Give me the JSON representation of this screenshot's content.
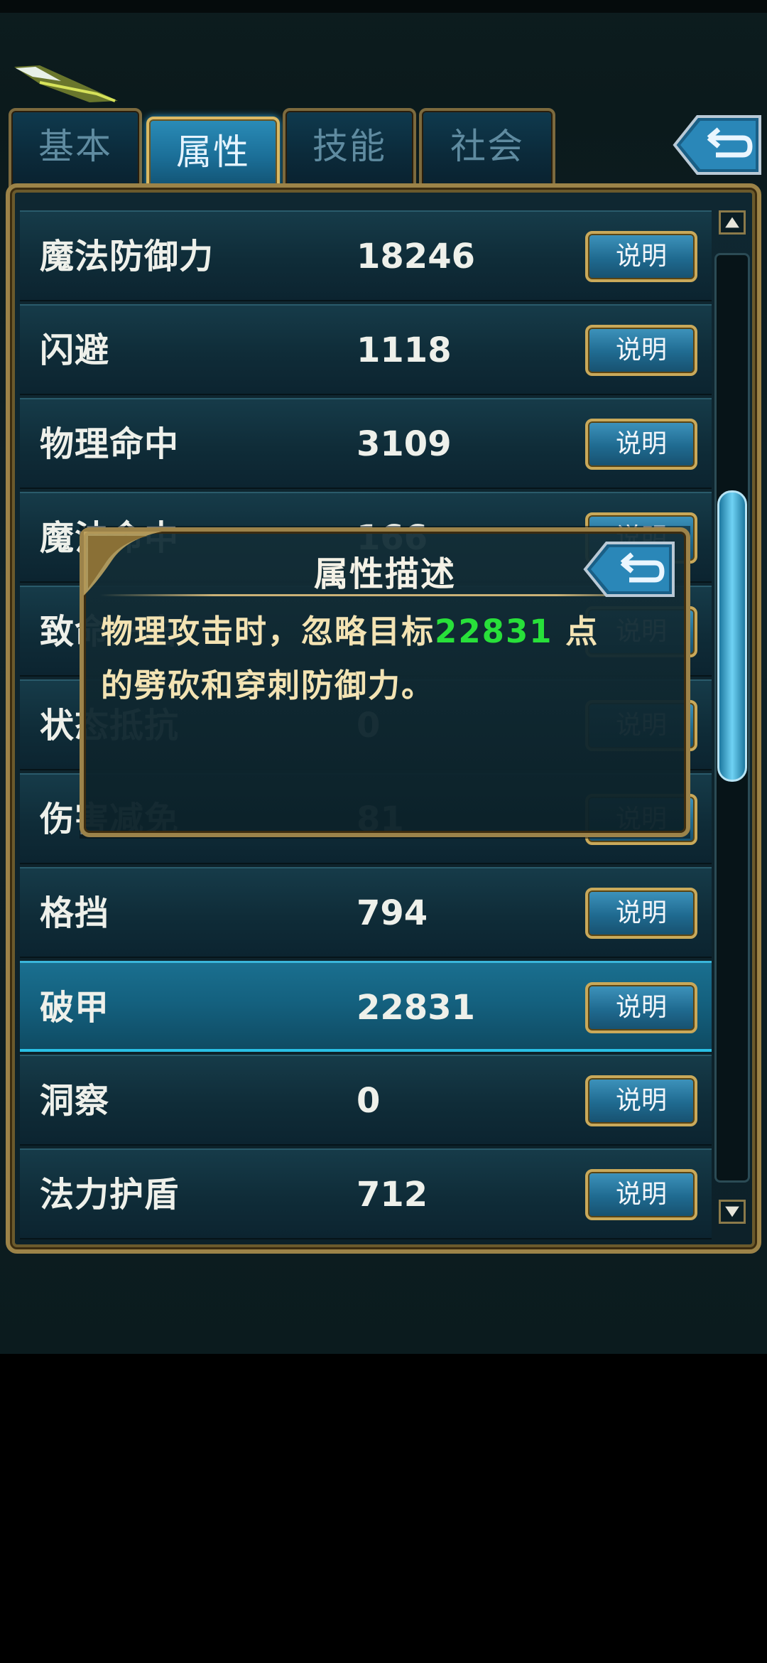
{
  "tabs": [
    {
      "label": "基本",
      "active": false
    },
    {
      "label": "属性",
      "active": true
    },
    {
      "label": "技能",
      "active": false
    },
    {
      "label": "社会",
      "active": false
    }
  ],
  "rows": [
    {
      "name": "魔法防御力",
      "value": "18246",
      "button": "说明",
      "highlighted": false
    },
    {
      "name": "闪避",
      "value": "1118",
      "button": "说明",
      "highlighted": false
    },
    {
      "name": "物理命中",
      "value": "3109",
      "button": "说明",
      "highlighted": false
    },
    {
      "name": "魔法命中",
      "value": "166",
      "button": "说明",
      "highlighted": false
    },
    {
      "name": "致命一击",
      "value": "",
      "button": "说明",
      "highlighted": false
    },
    {
      "name": "状态抵抗",
      "value": "0",
      "button": "说明",
      "highlighted": false
    },
    {
      "name": "伤害减免",
      "value": "81",
      "button": "说明",
      "highlighted": false
    },
    {
      "name": "格挡",
      "value": "794",
      "button": "说明",
      "highlighted": false
    },
    {
      "name": "破甲",
      "value": "22831",
      "button": "说明",
      "highlighted": true
    },
    {
      "name": "洞察",
      "value": "0",
      "button": "说明",
      "highlighted": false
    },
    {
      "name": "法力护盾",
      "value": "712",
      "button": "说明",
      "highlighted": false
    }
  ],
  "popup": {
    "title": "属性描述",
    "line1_before": "物理攻击时，忽略目标",
    "line1_number": "22831",
    "line1_after": " 点",
    "line2": "的劈砍和穿刺防御力。",
    "number_color": "#28e03a"
  },
  "colors": {
    "accent": "#2a9ad0",
    "frame_gold": "#9c8348",
    "text_light": "#eef0ea"
  },
  "icons": {
    "back": "back-arrow-icon",
    "scroll_up": "scroll-up-icon",
    "scroll_down": "scroll-down-icon"
  }
}
